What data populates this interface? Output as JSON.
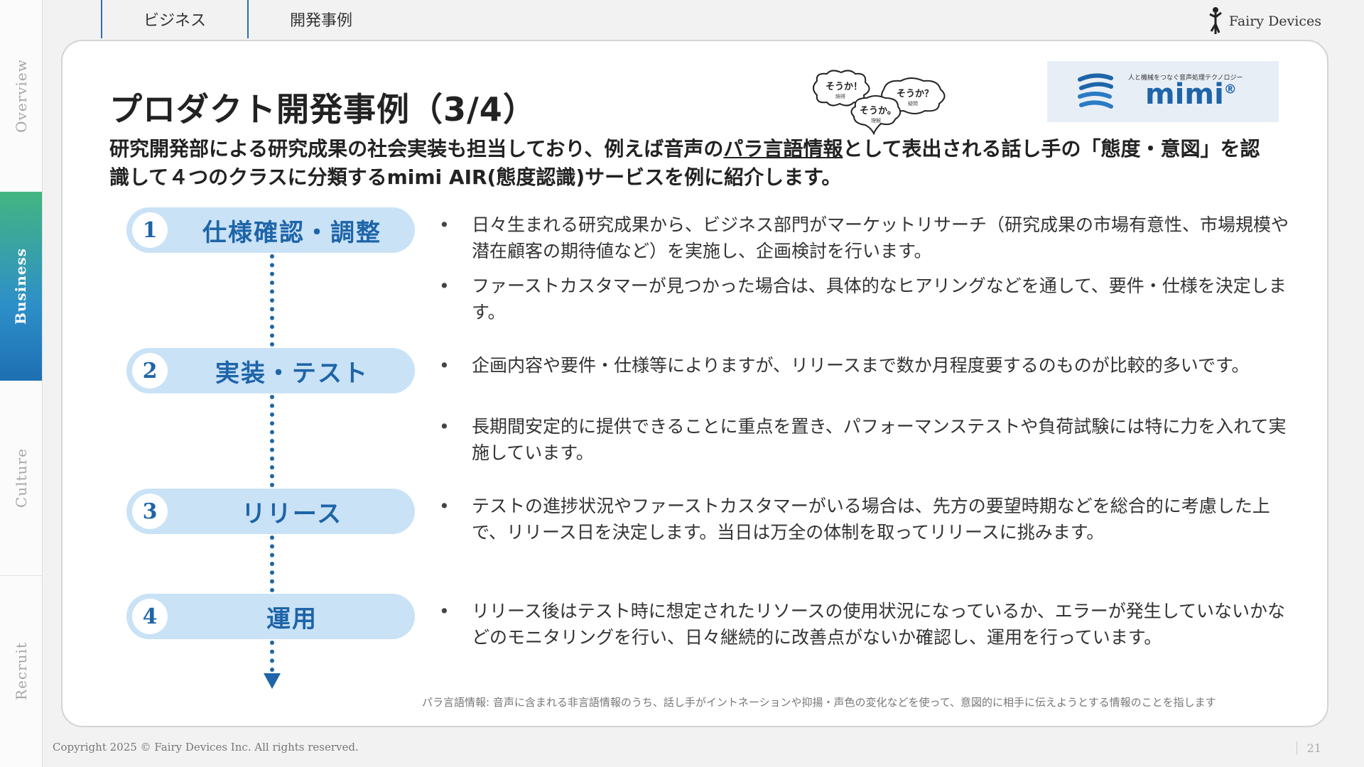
{
  "sidebar": {
    "items": [
      {
        "label": "Overview"
      },
      {
        "label": "Business"
      },
      {
        "label": "Culture"
      },
      {
        "label": "Recruit"
      }
    ]
  },
  "tabs": [
    "ビジネス",
    "開発事例"
  ],
  "brand": {
    "name": "Fairy Devices"
  },
  "slide": {
    "title": "プロダクト開発事例（3/4）",
    "subtitle_pre": "研究開発部による研究成果の社会実装も担当しており、例えば音声の",
    "subtitle_link": "パラ言語情報",
    "subtitle_post": "として表出される話し手の「態度・意図」を認識して４つのクラスに分類するmimi AIR(態度認識)サービスを例に紹介します。",
    "bubbles": [
      "そうか！",
      "そうか？",
      "そうか。"
    ],
    "bubble_notes": [
      "納得",
      "疑問",
      "理解"
    ],
    "logo_tagline": "人と機械をつなぐ音声処理テクノロジー",
    "logo_name": "mimi",
    "logo_mark": "®"
  },
  "steps": [
    {
      "num": "1",
      "label": "仕様確認・調整",
      "bullets": [
        "日々生まれる研究成果から、ビジネス部門がマーケットリサーチ（研究成果の市場有意性、市場規模や潜在顧客の期待値など）を実施し、企画検討を行います。",
        "ファーストカスタマーが見つかった場合は、具体的なヒアリングなどを通して、要件・仕様を決定します。"
      ]
    },
    {
      "num": "2",
      "label": "実装・テスト",
      "bullets": [
        "企画内容や要件・仕様等によりますが、リリースまで数か月程度要するのものが比較的多いです。",
        "長期間安定的に提供できることに重点を置き、パフォーマンステストや負荷試験には特に力を入れて実施しています。"
      ]
    },
    {
      "num": "3",
      "label": "リリース",
      "bullets": [
        "テストの進捗状況やファーストカスタマーがいる場合は、先方の要望時期などを総合的に考慮した上で、リリース日を決定します。当日は万全の体制を取ってリリースに挑みます。"
      ]
    },
    {
      "num": "4",
      "label": "運用",
      "bullets": [
        "リリース後はテスト時に想定されたリソースの使用状況になっているか、エラーが発生していないかなどのモニタリングを行い、日々継続的に改善点がないか確認し、運用を行っています。"
      ]
    }
  ],
  "footnote": "パラ言語情報: 音声に含まれる非言語情報のうち、話し手がイントネーションや抑揚・声色の変化などを使って、意図的に相手に伝えようとする情報のことを指します",
  "footer": {
    "copyright": "Copyright 2025 © Fairy Devices Inc. All rights reserved.",
    "page": "21"
  },
  "colors": {
    "accent": "#1e64a8",
    "step_bg": "#c9e2f6",
    "nav_active_top": "#43b581",
    "nav_active_bottom": "#1e6fb3"
  }
}
